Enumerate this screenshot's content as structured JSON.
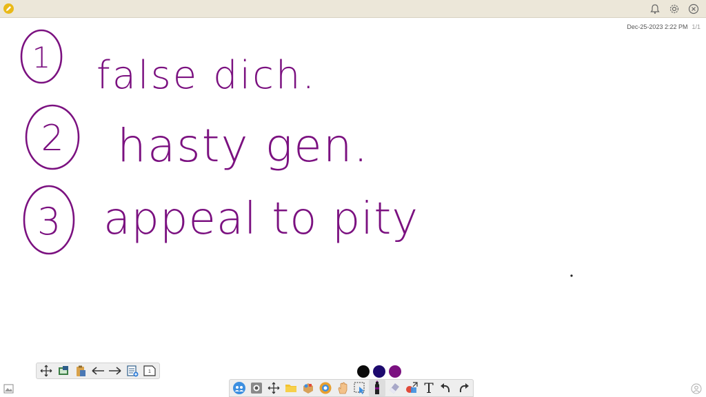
{
  "header": {
    "app_icon": "pencil-badge-icon",
    "actions": [
      {
        "name": "bell-icon",
        "label": "Notifications"
      },
      {
        "name": "gear-icon",
        "label": "Settings"
      },
      {
        "name": "close-icon",
        "label": "Close"
      }
    ]
  },
  "meta": {
    "timestamp": "Dec-25-2023 2:22 PM",
    "page_indicator": "1/1"
  },
  "whiteboard": {
    "ink_color": "#7b1180",
    "lines": [
      {
        "number": "1",
        "text": "false dich."
      },
      {
        "number": "2",
        "text": "hasty gen."
      },
      {
        "number": "3",
        "text": "appeal to pity"
      }
    ]
  },
  "left_toolbar": {
    "tools": [
      "move-icon",
      "screenshot-icon",
      "clipboard-icon",
      "arrow-left-icon",
      "arrow-right-icon",
      "add-page-icon",
      "page-icon"
    ],
    "page_badge": "1"
  },
  "palette": {
    "colors": [
      "#0b0b0b",
      "#1d0a6e",
      "#7b1180"
    ],
    "selected": 2
  },
  "main_toolbar": {
    "tools": [
      "participants-icon",
      "camera-icon",
      "move-icon",
      "folder-icon",
      "shapes-box-icon",
      "browser-icon",
      "hand-icon",
      "select-icon",
      "marker-icon",
      "eraser-icon",
      "shapes-icon",
      "text-icon",
      "undo-icon",
      "redo-icon"
    ],
    "text_tool_glyph": "T"
  }
}
